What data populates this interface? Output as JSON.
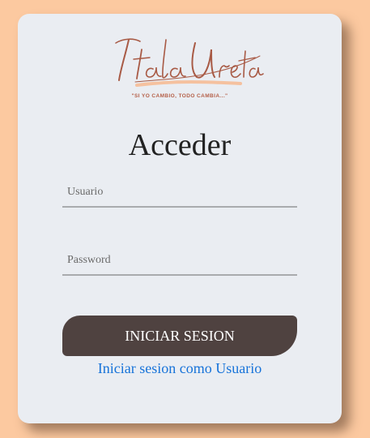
{
  "brand": {
    "logo_text": "Itala Ureta",
    "tagline": "\"SI YO CAMBIO, TODO CAMBIA...\""
  },
  "login": {
    "title": "Acceder",
    "username_placeholder": "Usuario",
    "password_placeholder": "Password",
    "submit_label": "INICIAR SESION",
    "alt_login_link": "Iniciar sesion como Usuario"
  },
  "colors": {
    "page_background": "#fcc9a0",
    "card_background": "#eaedf2",
    "button_background": "#4f4240",
    "link": "#1773d9",
    "logo_script": "#a85a45",
    "logo_underline": "#f7b58a"
  }
}
